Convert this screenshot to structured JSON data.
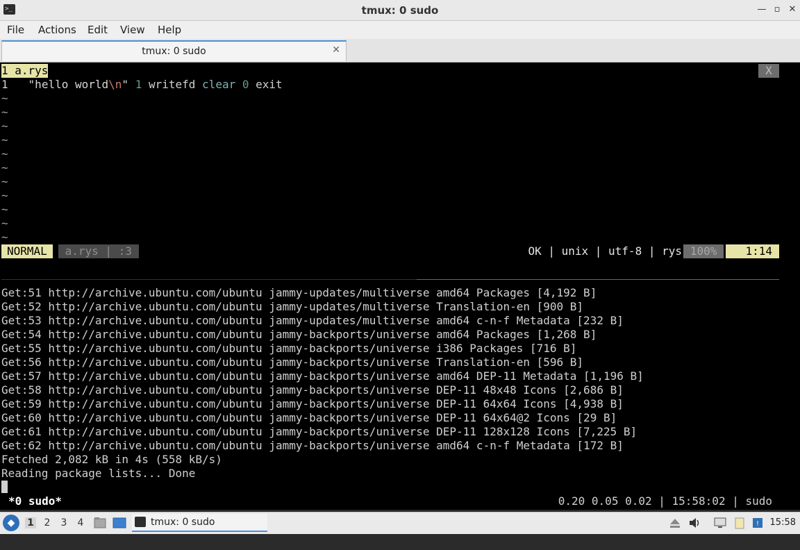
{
  "window": {
    "title": "tmux: 0 sudo",
    "app_icon_glyph": ">_",
    "minimize": "—",
    "restore": "▫",
    "maximize": "□",
    "close": "✕"
  },
  "menu": {
    "items": [
      "File",
      "Actions",
      "Edit",
      "View",
      "Help"
    ]
  },
  "tab": {
    "title": "tmux: 0 sudo",
    "close": "✕"
  },
  "editor": {
    "buffer_tab": "1 a.rys",
    "buffer_close": "X",
    "line_number": "1",
    "code": {
      "str_open": "\"hello world",
      "esc": "\\n",
      "str_close": "\"",
      "num1": "1",
      "fn1": "writefd",
      "kw": "clear",
      "num2": "0",
      "fn2": "exit"
    },
    "tilde": "~",
    "status": {
      "mode": "NORMAL",
      "file": " a.rys | :3 ",
      "right": "OK | unix | utf-8 | rys",
      "percent": " 100% ",
      "position": "1:14"
    }
  },
  "output_lines": [
    "Get:51 http://archive.ubuntu.com/ubuntu jammy-updates/multiverse amd64 Packages [4,192 B]",
    "Get:52 http://archive.ubuntu.com/ubuntu jammy-updates/multiverse Translation-en [900 B]",
    "Get:53 http://archive.ubuntu.com/ubuntu jammy-updates/multiverse amd64 c-n-f Metadata [232 B]",
    "Get:54 http://archive.ubuntu.com/ubuntu jammy-backports/universe amd64 Packages [1,268 B]",
    "Get:55 http://archive.ubuntu.com/ubuntu jammy-backports/universe i386 Packages [716 B]",
    "Get:56 http://archive.ubuntu.com/ubuntu jammy-backports/universe Translation-en [596 B]",
    "Get:57 http://archive.ubuntu.com/ubuntu jammy-backports/universe amd64 DEP-11 Metadata [1,196 B]",
    "Get:58 http://archive.ubuntu.com/ubuntu jammy-backports/universe DEP-11 48x48 Icons [2,686 B]",
    "Get:59 http://archive.ubuntu.com/ubuntu jammy-backports/universe DEP-11 64x64 Icons [4,938 B]",
    "Get:60 http://archive.ubuntu.com/ubuntu jammy-backports/universe DEP-11 64x64@2 Icons [29 B]",
    "Get:61 http://archive.ubuntu.com/ubuntu jammy-backports/universe DEP-11 128x128 Icons [7,225 B]",
    "Get:62 http://archive.ubuntu.com/ubuntu jammy-backports/universe amd64 c-n-f Metadata [172 B]",
    "Fetched 2,082 kB in 4s (558 kB/s)",
    "Reading package lists... Done"
  ],
  "tmux": {
    "window": "*0 sudo*",
    "right": "0.20 0.05 0.02 | 15:58:02 | sudo"
  },
  "taskbar": {
    "workspaces": [
      "1",
      "2",
      "3",
      "4"
    ],
    "task_label": "tmux: 0 sudo",
    "clock": "15:58"
  },
  "colors": {
    "terminal_bg": "#000000",
    "statusline_accent": "#e7e4a8",
    "taskbar_accent": "#4b8fd6"
  }
}
